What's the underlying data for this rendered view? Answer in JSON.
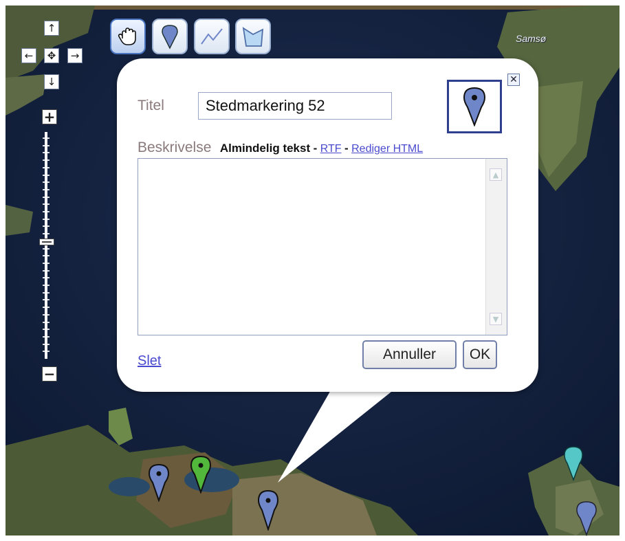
{
  "map": {
    "place_label": "Samsø",
    "pins": [
      {
        "color": "#6f86c9"
      },
      {
        "color": "#52b83c"
      },
      {
        "color": "#6f86c9"
      },
      {
        "color": "#56c7c7"
      },
      {
        "color": "#6f86c9"
      }
    ]
  },
  "navigation": {
    "up_icon": "arrow-up-icon",
    "left_icon": "arrow-left-icon",
    "center_icon": "center-icon",
    "right_icon": "arrow-right-icon",
    "down_icon": "arrow-down-icon",
    "zoom_in_label": "+",
    "zoom_out_label": "−",
    "zoom_level": 0.5
  },
  "toolbar": {
    "tools": [
      "hand-icon",
      "placemark-icon",
      "line-icon",
      "polygon-icon"
    ],
    "active": "hand-icon"
  },
  "editor": {
    "title_label": "Titel",
    "title_value": "Stedmarkering 52",
    "description_label": "Beskrivelse",
    "mode_plain": "Almindelig tekst",
    "separator": "-",
    "mode_rtf": "RTF",
    "mode_html": "Rediger HTML",
    "description_value": "",
    "delete_label": "Slet",
    "cancel_label": "Annuller",
    "ok_label": "OK",
    "close_label": "✕",
    "accent_color": "#2f3f8f"
  }
}
